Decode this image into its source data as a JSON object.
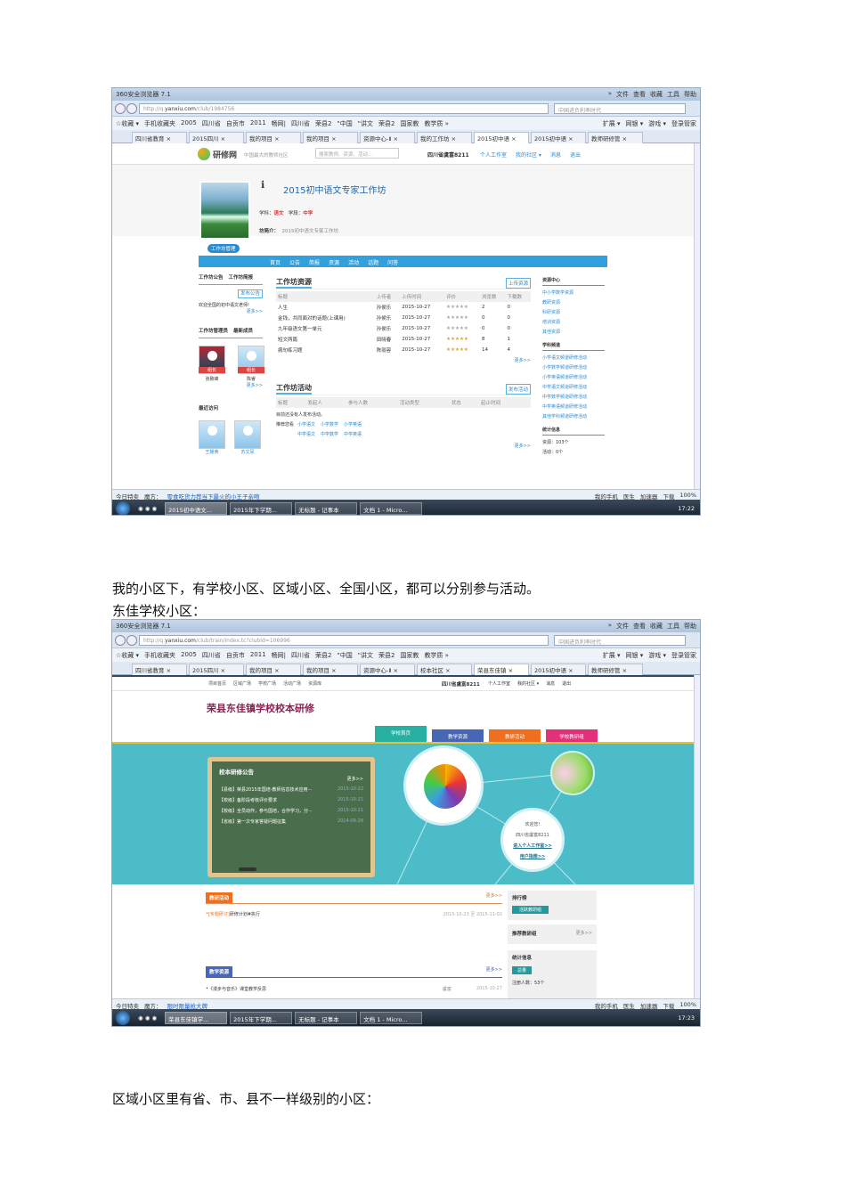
{
  "shot1": {
    "browser": {
      "title": "360安全浏览器 7.1",
      "menus": [
        "»",
        "文件",
        "查看",
        "收藏",
        "工具",
        "帮助"
      ],
      "url_prefix": "http://q.",
      "url_domain": "yanxiu.com",
      "url_path": "/club/1984756",
      "search_placeholder": "中国进负利率时代",
      "bookmarks": [
        "☆收藏 ▾",
        "手机收藏夹",
        "2005",
        "四川省",
        "自贡市",
        "2011",
        "畅网|",
        "四川省",
        "荣县2",
        "\"中国",
        "\"讲文",
        "荣县2",
        "国家教",
        "教学质 »"
      ],
      "bookmarks_right": [
        "扩展 ▾",
        "网银 ▾",
        "游戏 ▾",
        "登录管家"
      ],
      "tabs": [
        "四川省教育 ×",
        "2015四川 ×",
        "我的项目 ×",
        "我的项目 ×",
        "资源中心-Ⅱ ×",
        "我的工作坊 ×",
        "2015初中语 ×",
        "2015初中语 ×",
        "教师研修管 ×"
      ],
      "active_tab": 6
    },
    "site": {
      "logo": "研修网",
      "slogan": "中国最大的教师社区",
      "search_placeholder": "搜索教师、资源、活动...",
      "user": "四川省虞富8211",
      "links": [
        "个人工作室",
        "我的社区 ▾",
        "消息",
        "退出"
      ],
      "msg_count": "0"
    },
    "workshop": {
      "title": "2015初中语文专家工作坊",
      "subject_label": "学科：",
      "subject": "语文",
      "stage_label": "学段：",
      "stage": "中学",
      "intro_label": "坊简介：",
      "intro": "2015初中语文专家工作坊",
      "manage_btn": "工作坊管理",
      "nav": [
        "首页",
        "公告",
        "简报",
        "资源",
        "活动",
        "话题",
        "问答"
      ]
    },
    "left": {
      "tabs1": [
        "工作坊公告",
        "工作坊简报"
      ],
      "post_btn": "发布公告",
      "notice": "欢迎全国的初中语文老师!",
      "more": "更多>>",
      "tabs2": [
        "工作坊管理员",
        "最新成员"
      ],
      "admins": [
        {
          "name": "张致峰",
          "badge": "组长"
        },
        {
          "name": "陈睿",
          "badge": "组长"
        }
      ],
      "recent_title": "最近访问",
      "visitors": [
        "王媛英",
        "苏文凤"
      ]
    },
    "resources": {
      "title": "工作坊资源",
      "upload_btn": "上传资源",
      "headers": [
        "标题",
        "上传者",
        "上传时间",
        "评价",
        "浏览数",
        "下载数"
      ],
      "rows": [
        [
          "人生",
          "孙侯乐",
          "2015-10-27",
          0,
          "2",
          "0"
        ],
        [
          "金钱，共同面对的话题(上课用)",
          "孙侯乐",
          "2015-10-27",
          0,
          "0",
          "0"
        ],
        [
          "九年级语文第一单元",
          "孙侯乐",
          "2015-10-27",
          0,
          "0",
          "0"
        ],
        [
          "短文两篇",
          "田晓春",
          "2015-10-27",
          5,
          "8",
          "1"
        ],
        [
          "病句练习题",
          "陈丽容",
          "2015-10-27",
          5,
          "14",
          "4"
        ]
      ],
      "more": "更多>>"
    },
    "activities": {
      "title": "工作坊活动",
      "post_btn": "发布活动",
      "headers": [
        "标题",
        "发起人",
        "参与人数",
        "活动类型",
        "状态",
        "起止时间"
      ],
      "empty": "目前还没有人发布活动。",
      "recommend_label": "推荐您看",
      "recommend": [
        "小学语文",
        "小学数学",
        "小学英语",
        "中学语文",
        "中学数学",
        "中学英语"
      ],
      "more": "更多>>"
    },
    "right": {
      "res_title": "资源中心",
      "res_links": [
        "中小学数学资源",
        "教研资源",
        "科研资源",
        "培训资源",
        "其他资源"
      ],
      "ch_title": "学科频道",
      "ch_links": [
        "小学语文频道研修活动",
        "小学数学频道研修活动",
        "小学英语频道研修活动",
        "中学语文频道研修活动",
        "中学数学频道研修活动",
        "中学英语频道研修活动",
        "其他学科频道研修活动"
      ],
      "stat_title": "统计信息",
      "stat": "资源：103个",
      "stat2": "活动：0个"
    },
    "status": {
      "items": [
        "今日特卖",
        "魔方："
      ],
      "ad": "零食吃货力荐当下最火的小王子亲吻",
      "right": [
        "我的手机",
        "医生",
        "加速器",
        "下载",
        "100%"
      ]
    },
    "taskbar": {
      "tasks": [
        "2015初中语文...",
        "2015年下学期...",
        "无标题 - 记事本",
        "文档 1 - Micro..."
      ],
      "clock": "17:22"
    }
  },
  "paragraph1": "我的小区下，有学校小区、区域小区、全国小区，都可以分别参与活动。",
  "paragraph2": "东佳学校小区：",
  "shot2": {
    "browser": {
      "title": "360安全浏览器 7.1",
      "menus": [
        "»",
        "文件",
        "查看",
        "收藏",
        "工具",
        "帮助"
      ],
      "url_prefix": "http://q.",
      "url_domain": "yanxiu.com",
      "url_path": "/club/train/index.tc?clubId=106996",
      "search_placeholder": "中国进负利率时代",
      "bookmarks": [
        "☆收藏 ▾",
        "手机收藏夹",
        "2005",
        "四川省",
        "自贡市",
        "2011",
        "畅网|",
        "四川省",
        "荣县2",
        "\"中国",
        "\"讲文",
        "荣县2",
        "国家教",
        "教学质 »"
      ],
      "bookmarks_right": [
        "扩展 ▾",
        "网银 ▾",
        "游戏 ▾",
        "登录管家"
      ],
      "tabs": [
        "四川省教育 ×",
        "2015四川 ×",
        "我的项目 ×",
        "我的项目 ×",
        "资源中心-Ⅱ ×",
        "校本社区 ×",
        "荣县东佳镇 ×",
        "2015初中语 ×",
        "教师研修管 ×"
      ],
      "active_tab": 6
    },
    "topnav": [
      "项目首页",
      "区域广场",
      "学校广场",
      "活动广场",
      "资源库"
    ],
    "user": "四川省虞富8211",
    "user_links": [
      "个人工作室",
      "我的社区 ▾",
      "消息",
      "退出"
    ],
    "msg_count": "0",
    "school_title": "荣县东佳镇学校校本研修",
    "school_tabs": [
      {
        "label": "学校首页",
        "color": "#27b0a2"
      },
      {
        "label": "教学资源",
        "color": "#4766b5"
      },
      {
        "label": "教研活动",
        "color": "#ef6f1e"
      },
      {
        "label": "学校教研组",
        "color": "#e2307a"
      }
    ],
    "board": {
      "title": "校本研修公告",
      "more": "更多>>",
      "items": [
        [
          "【县级】荣县2015年国培-教师信息技术应用···",
          "2015-10-22"
        ],
        [
          "【校级】备阶段考核评价要求",
          "2015-10-21"
        ],
        [
          "【校级】全员动作，参与国培，合作学习，分···",
          "2015-10-21"
        ],
        [
          "【省级】第一次专家答疑问题征集",
          "2014-09-28"
        ]
      ]
    },
    "welcome": {
      "greet": "欢迎您!",
      "user": "四川省虞富8211",
      "link1": "进入个人工作室>>",
      "link2": "用户指南>>"
    },
    "research": {
      "title": "教研活动",
      "more": "更多>>",
      "tag": "[专题研讨]",
      "item": "研修计划#执行",
      "date": "2015-10-23 至 2015-11-02"
    },
    "teach_res": {
      "title": "教学资源",
      "more": "更多>>",
      "item": "《漫步与音乐》课堂教学反思",
      "author": "虞富",
      "date": "2015-10-27"
    },
    "rank": {
      "title": "排行榜",
      "btn": "活跃教研组"
    },
    "recommend": {
      "title": "推荐教研组",
      "more": "更多>>"
    },
    "stats": {
      "title": "统计信息",
      "btn": "总量",
      "reg": "注册人数：53个"
    },
    "status": {
      "items": [
        "今日特卖",
        "魔方："
      ],
      "ad": "限时限量抢大牌",
      "right": [
        "我的手机",
        "医生",
        "加速器",
        "下载",
        "100%"
      ]
    },
    "taskbar": {
      "tasks": [
        "荣县东佳镇学...",
        "2015年下学期...",
        "无标题 - 记事本",
        "文档 1 - Micro..."
      ],
      "clock": "17:23"
    }
  },
  "paragraph3": "区域小区里有省、市、县不一样级别的小区："
}
